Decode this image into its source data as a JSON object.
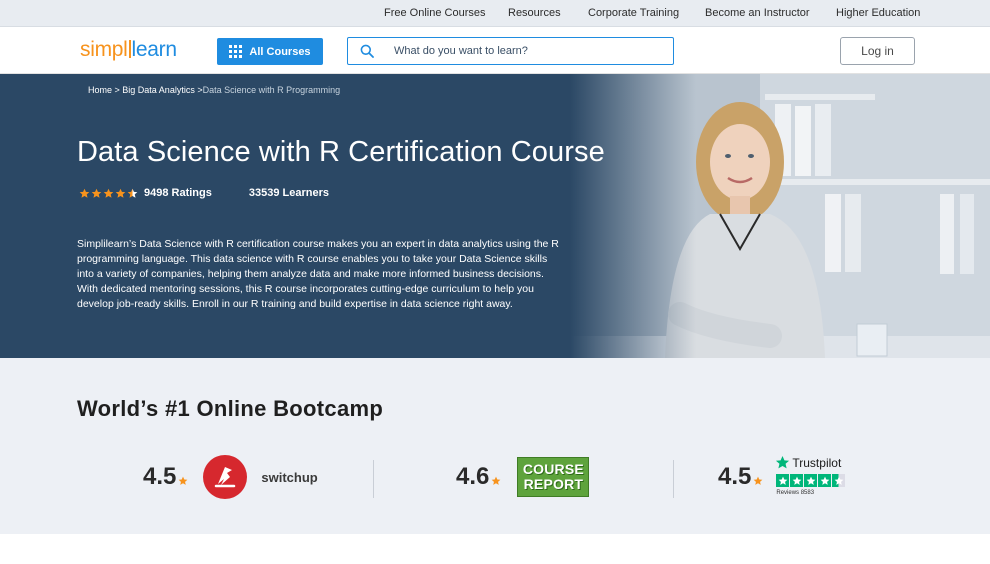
{
  "topnav": {
    "items": [
      "Free Online Courses",
      "Resources",
      "Corporate Training",
      "Become an Instructor",
      "Higher Education"
    ]
  },
  "header": {
    "logo_part1": "simpl",
    "logo_part2": "learn",
    "all_courses_label": "All Courses",
    "search_placeholder": "What do you want to learn?",
    "login_label": "Log in"
  },
  "breadcrumb": {
    "home": "Home",
    "sep1": " > ",
    "category": "Big Data Analytics",
    "sep2": " >",
    "current": "Data Science with R Programming"
  },
  "hero": {
    "title": "Data Science with R Certification Course",
    "star_rating": 4.5,
    "ratings": "9498 Ratings",
    "learners": "33539 Learners",
    "description": "Simplilearn’s Data Science with R certification course makes you an expert in data analytics using the R programming language. This data science with R course enables you to take your Data Science skills into a variety of companies, helping them analyze data and make more informed business decisions. With dedicated mentoring sessions, this R course incorporates cutting-edge curriculum to help you develop job-ready skills. Enroll in our R training and build expertise in data science right away."
  },
  "bootcamp": {
    "title_normal": "World’s #1 ",
    "title_bold": "Online Bootcamp",
    "ratings": [
      {
        "score": "4.5",
        "platform": "switchup"
      },
      {
        "score": "4.6",
        "logo_line1": "COURSE",
        "logo_line2": "REPORT"
      },
      {
        "score": "4.5",
        "brand": "Trustpilot",
        "reviews": "Reviews 8583"
      }
    ]
  },
  "colors": {
    "brand_orange": "#f7931d",
    "brand_blue": "#1f8ce0",
    "hero_navy": "#2b4865",
    "section_bg": "#edf0f5",
    "trustpilot_green": "#00b67a",
    "course_report_green": "#5ea33c"
  }
}
